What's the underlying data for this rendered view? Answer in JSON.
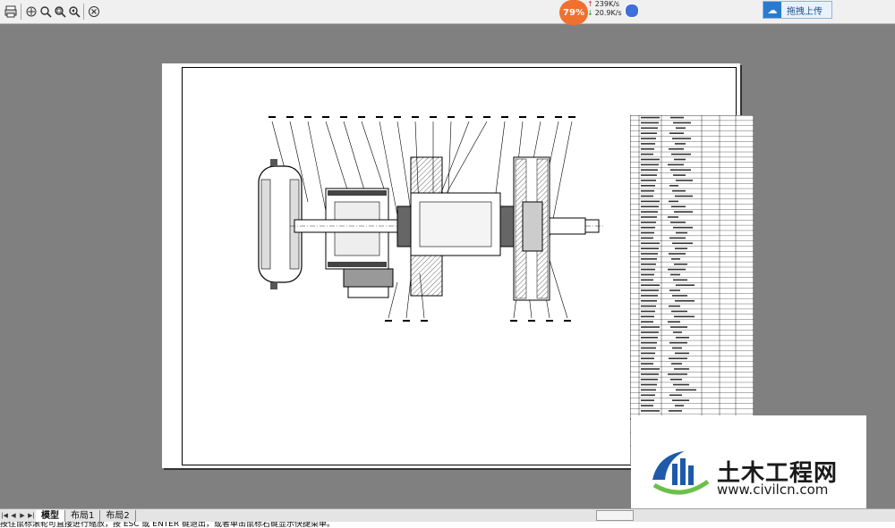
{
  "toolbar": {
    "buttons": [
      "print-icon",
      "pan-icon",
      "zoom-icon",
      "zoom-window-icon",
      "zoom-previous-icon",
      "close-icon"
    ]
  },
  "netspeed": {
    "percent": "79%",
    "up": "239K/s",
    "down": "20.9K/s"
  },
  "upload": {
    "label": "拖拽上传"
  },
  "tabs": {
    "items": [
      "模型",
      "布局1",
      "布局2"
    ],
    "active": "模型"
  },
  "command_line": {
    "text": "按住鼠标滚轮可直接进行缩放，按 ESC 或 ENTER 键退出，或者单击鼠标右键显示快捷菜单。"
  },
  "watermark": {
    "title": "土木工程网",
    "url": "www.civilcn.com"
  },
  "colors": {
    "workspace": "#808080",
    "badge": "#f07030",
    "watermark_blue": "#1e5aa8",
    "watermark_green": "#6cc04a"
  }
}
